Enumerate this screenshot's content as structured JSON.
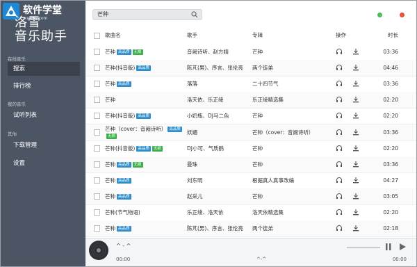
{
  "watermark": {
    "text": "软件学堂",
    "url": "xue51.com"
  },
  "app": {
    "title_line1": "洛雪",
    "title_line2": "音乐助手"
  },
  "sidebar": {
    "online_section": "在线音乐",
    "search": "搜索",
    "charts": "排行榜",
    "my_section": "我的音乐",
    "trial_list": "试听列表",
    "other_section": "其他",
    "download_manager": "下载管理",
    "settings": "设置"
  },
  "search": {
    "value": "芒种"
  },
  "window": {
    "colors": {
      "green": "#4cbb5a",
      "red": "#e8503a"
    }
  },
  "table": {
    "headers": {
      "song": "歌曲名",
      "singer": "歌手",
      "album": "专辑",
      "action": "操作",
      "duration": "时长"
    },
    "tags": {
      "hq": "高品质",
      "ns": "无损"
    },
    "rows": [
      {
        "song": "芒种",
        "hq": true,
        "ns": true,
        "singer": "音阙诗听、赵方婧",
        "album": "芒种",
        "duration": "03:36"
      },
      {
        "song": "芒种(抖音版)",
        "hq": true,
        "ns": false,
        "singer": "陈芃(男)、序言、张伦亮",
        "album": "两个徒弟",
        "duration": "04:46"
      },
      {
        "song": "芒种",
        "hq": true,
        "ns": false,
        "singer": "落落",
        "album": "二十四节气",
        "duration": "03:36"
      },
      {
        "song": "芒种",
        "hq": false,
        "ns": false,
        "singer": "洛天依、乐正绫",
        "album": "乐正绫精选集",
        "duration": "02:20"
      },
      {
        "song": "芒种(抖音版)",
        "hq": true,
        "ns": false,
        "singer": "小奶瓶、DJ马二色",
        "album": "芒种",
        "duration": "02:20"
      },
      {
        "song": "芒种（cover：音阙诗听）",
        "hq": true,
        "ns": true,
        "singer": "妖媚",
        "album": "芒种（cover：音阙诗听）",
        "duration": "03:36",
        "two_line": true
      },
      {
        "song": "芒种(抖音版)",
        "hq": true,
        "ns": true,
        "singer": "DJ小可、气质鹤",
        "album": "芒种",
        "duration": "02:20"
      },
      {
        "song": "芒种",
        "hq": true,
        "ns": true,
        "singer": "曼珠",
        "album": "芒种",
        "duration": "03:36"
      },
      {
        "song": "芒种",
        "hq": true,
        "ns": false,
        "singer": "刘东明",
        "album": "根据真人真事改编",
        "duration": "04:27"
      },
      {
        "song": "芒种",
        "hq": true,
        "ns": false,
        "singer": "赵采儿",
        "album": "芒种",
        "duration": "03:05"
      },
      {
        "song": "芒种(节气物语)",
        "hq": false,
        "ns": false,
        "singer": "乐正绫、洛天依",
        "album": "洛天依精选集",
        "duration": "02:20"
      },
      {
        "song": "芒种",
        "hq": true,
        "ns": false,
        "singer": "陈芃(男)、序言、张伦亮",
        "album": "两个徒弟",
        "duration": "02:18"
      }
    ]
  },
  "player": {
    "song": "^ - ^",
    "time_start": "00:00",
    "time_mid": "^-^",
    "time_end": "00:00"
  }
}
